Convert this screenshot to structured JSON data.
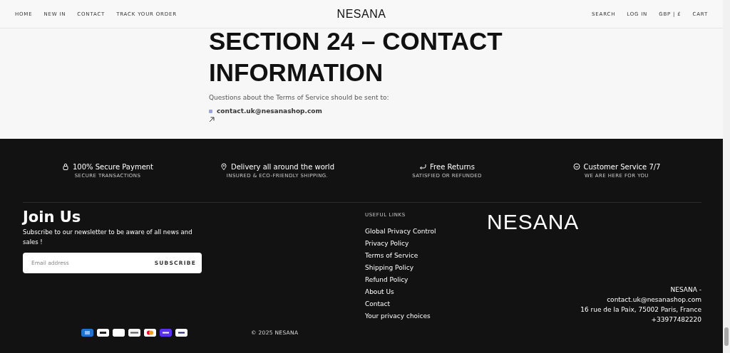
{
  "header": {
    "nav_left": [
      "HOME",
      "NEW IN",
      "CONTACT",
      "TRACK YOUR ORDER"
    ],
    "logo": "NESANA",
    "nav_right": [
      "SEARCH",
      "LOG IN",
      "GBP | £",
      "CART"
    ]
  },
  "section": {
    "heading": "SECTION 24 – CONTACT INFORMATION",
    "text": "Questions about the Terms of Service should be sent to:",
    "email": "contact.uk@nesanashop.com"
  },
  "features": [
    {
      "kind": "lock",
      "title": "100% Secure Payment",
      "subtitle": "SECURE TRANSACTIONS"
    },
    {
      "kind": "pin",
      "title": "Delivery all around the world",
      "subtitle": "INSURED & ECO-FRIENDLY SHIPPING."
    },
    {
      "kind": "return",
      "title": "Free Returns",
      "subtitle": "SATISFIED OR REFUNDED"
    },
    {
      "kind": "chat",
      "title": "Customer Service 7/7",
      "subtitle": "WE ARE HERE FOR YOU"
    }
  ],
  "newsletter": {
    "title": "Join Us",
    "text": "Subscribe to our newsletter to be aware of all news and sales !",
    "placeholder": "Email address",
    "button": "SUBSCRIBE"
  },
  "useful_links": {
    "title": "USEFUL LINKS",
    "links": [
      "Global Privacy Control",
      "Privacy Policy",
      "Terms of Service",
      "Shipping Policy",
      "Refund Policy",
      "About Us",
      "Contact",
      "Your privacy choices"
    ]
  },
  "footer_logo": "NESANA",
  "address": [
    "NESANA -",
    "contact.uk@nesanashop.com",
    "16 rue de la Paix, 75002 Paris, France",
    "+33977482220"
  ],
  "payment_methods": [
    {
      "kind": "amex",
      "color": "#1f72cd"
    },
    {
      "kind": "applepay",
      "color": "#ffffff"
    },
    {
      "kind": "blank",
      "color": "#ffffff"
    },
    {
      "kind": "klarna",
      "color": "#f3f3f3"
    },
    {
      "kind": "mastercard",
      "color": "#ffffff"
    },
    {
      "kind": "shop",
      "color": "#5a31f4"
    },
    {
      "kind": "visa",
      "color": "#ffffff"
    }
  ],
  "copyright": "© 2025 NESANA"
}
